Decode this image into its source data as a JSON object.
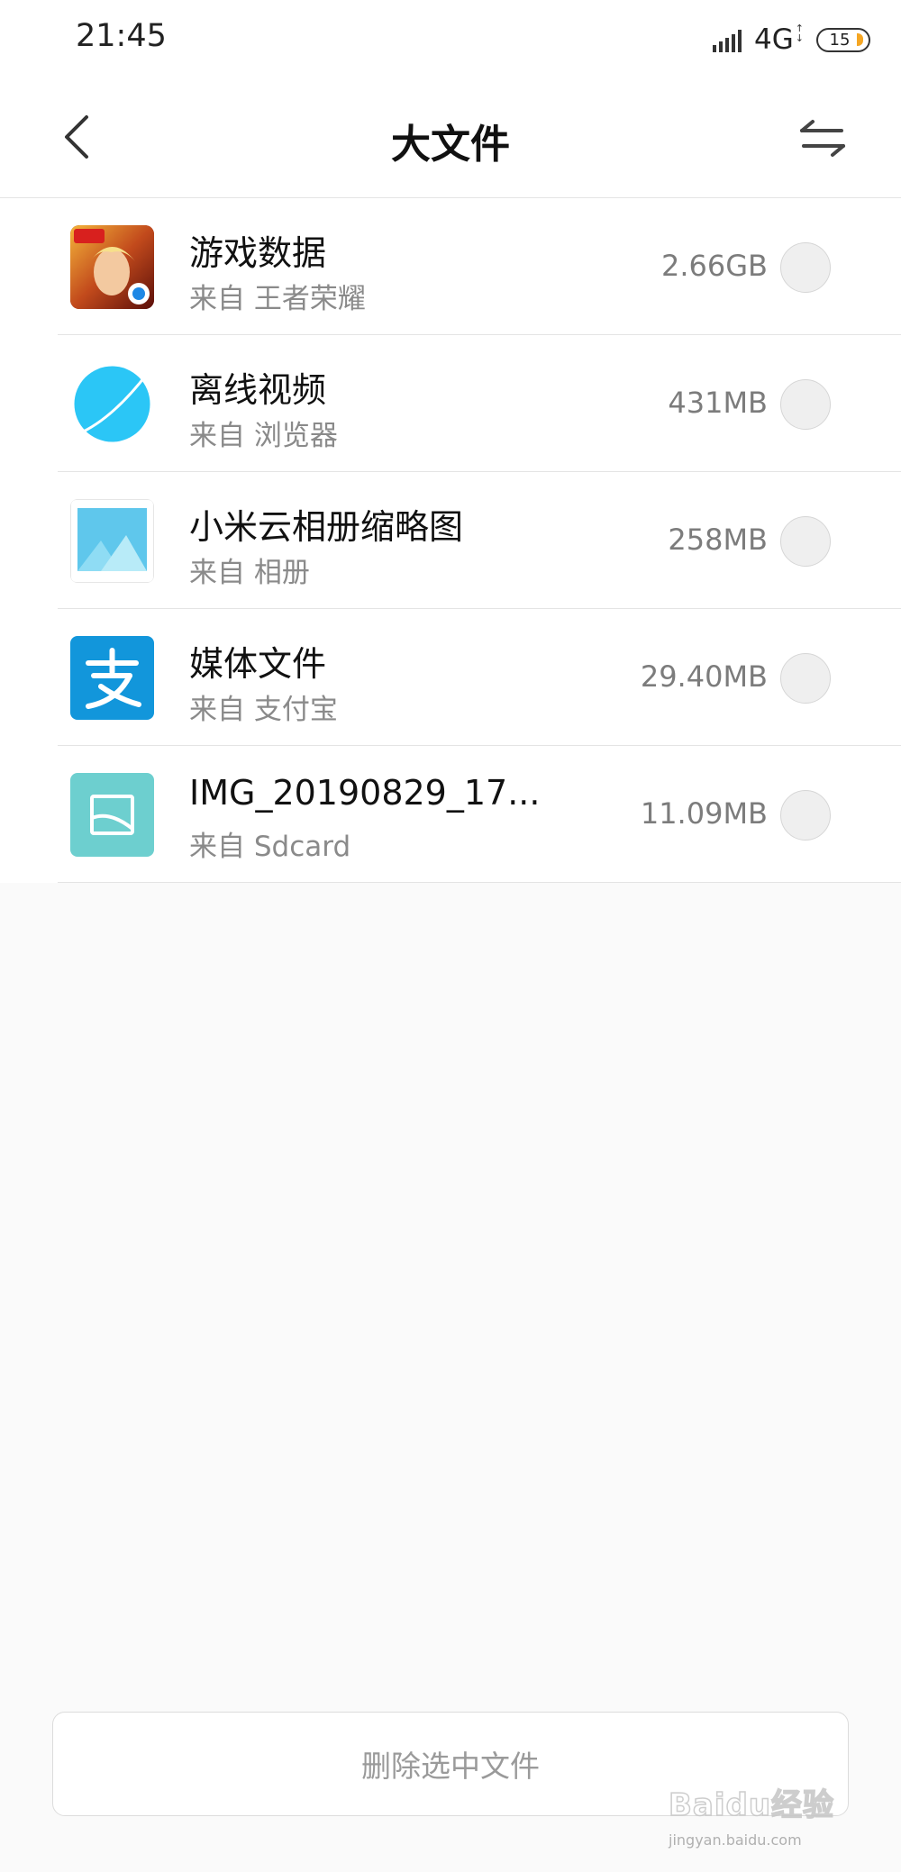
{
  "status_bar": {
    "time": "21:45",
    "network": "4G",
    "battery": "15"
  },
  "header": {
    "title": "大文件",
    "back_icon": "chevron-left-icon",
    "sort_icon": "swap-arrows-icon"
  },
  "files": [
    {
      "name": "游戏数据",
      "source": "来自 王者荣耀",
      "size": "2.66GB",
      "icon": "game-app-icon",
      "selected": false
    },
    {
      "name": "离线视频",
      "source": "来自 浏览器",
      "size": "431MB",
      "icon": "browser-planet-icon",
      "selected": false
    },
    {
      "name": "小米云相册缩略图",
      "source": "来自 相册",
      "size": "258MB",
      "icon": "gallery-icon",
      "selected": false
    },
    {
      "name": "媒体文件",
      "source": "来自 支付宝",
      "size": "29.40MB",
      "icon": "alipay-icon",
      "selected": false
    },
    {
      "name": "IMG_20190829_17...",
      "source": "来自 Sdcard",
      "size": "11.09MB",
      "icon": "image-file-icon",
      "selected": false
    }
  ],
  "footer": {
    "delete_label": "删除选中文件"
  },
  "watermark": {
    "logo": "Baidu经验",
    "url": "jingyan.baidu.com"
  },
  "colors": {
    "browser_blue": "#2bc6f6",
    "alipay_blue": "#1296db",
    "image_teal": "#6dcfcf",
    "gallery_sky": "#5fc7ec"
  }
}
